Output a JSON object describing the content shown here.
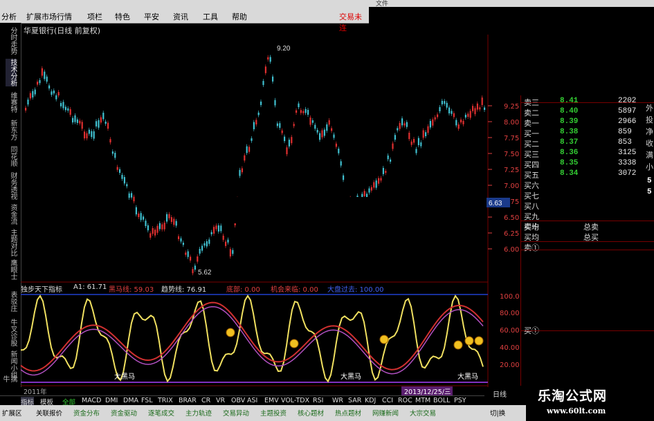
{
  "menu": {
    "items": [
      "分析",
      "扩展市场行情",
      "项栏",
      "特色",
      "平安",
      "资讯",
      "工具",
      "帮助"
    ],
    "right_label": "交易未连",
    "window_menu": "文件"
  },
  "sidebar": {
    "items": [
      "分时走势",
      "技术分析",
      "维赛特",
      "新东方",
      "同花顺",
      "财务透视",
      "资金流",
      "主题对比",
      "鹰眼士",
      "表驳庄",
      "牛叉诊股",
      "新闻小组",
      "擒牛"
    ]
  },
  "chart": {
    "title": "华夏银行(日线 前复权)",
    "high_label": "9.20",
    "low_label": "5.62",
    "price_axis": [
      "9.25",
      "8.00",
      "7.75",
      "7.50",
      "7.25",
      "7.00",
      "6.75",
      "6.50",
      "6.25",
      "6.00"
    ],
    "current_price": "6.63",
    "colors": {
      "up": "#e03030",
      "down": "#40c0d0",
      "ma": "#e0e0e0"
    }
  },
  "indicator": {
    "name": "独步天下指标",
    "a1": "A1: 61.71",
    "heima": "黑马线: 59.03",
    "trend": "趋势线: 76.91",
    "kuangu": "底部: 0.00",
    "jihui": "机会来临: 0.00",
    "dakeguo": "大盘过去: 100.00",
    "axis": [
      "100.0",
      "80.00",
      "60.00",
      "40.00",
      "20.00"
    ],
    "annot": [
      "大黑马",
      "大黑马",
      "大黑马"
    ],
    "timeline_left": "2011年",
    "date_tag": "2013/12/25/三",
    "period": "日线"
  },
  "quote": {
    "rows": [
      {
        "label": "卖三",
        "price": "8.41",
        "vol": "2202"
      },
      {
        "label": "卖二",
        "price": "8.40",
        "vol": "5897"
      },
      {
        "label": "卖一",
        "price": "8.39",
        "vol": "2966"
      },
      {
        "label": "买一",
        "price": "8.38",
        "vol": "859"
      },
      {
        "label": "买二",
        "price": "8.37",
        "vol": "853"
      },
      {
        "label": "买三",
        "price": "8.36",
        "vol": "3125"
      },
      {
        "label": "买四",
        "price": "8.35",
        "vol": "3338"
      },
      {
        "label": "买五",
        "price": "8.34",
        "vol": "3072"
      },
      {
        "label": "买六",
        "price": "",
        "vol": ""
      },
      {
        "label": "买七",
        "price": "",
        "vol": ""
      },
      {
        "label": "买八",
        "price": "",
        "vol": ""
      },
      {
        "label": "买九",
        "price": "",
        "vol": ""
      },
      {
        "label": "买十",
        "price": "",
        "vol": ""
      }
    ],
    "avg_sell": "卖均",
    "total_sell": "总卖",
    "avg_buy": "买均",
    "total_buy": "总买",
    "sell1_label": "卖①",
    "buy1_label": "买①",
    "side_chars": [
      "外",
      "投",
      "净",
      "收",
      "满",
      "小"
    ],
    "side_vals": [
      "5",
      "5"
    ]
  },
  "tabs": [
    "指标",
    "模板",
    "全部",
    "MACD",
    "DMI",
    "DMA",
    "FSL",
    "TRIX",
    "BRAR",
    "CR",
    "VR",
    "OBV",
    "ASI",
    "EMV",
    "VOL-TDX",
    "RSI",
    "WR",
    "SAR",
    "KDJ",
    "CCI",
    "ROC",
    "MTM",
    "BOLL",
    "PSY"
  ],
  "bottom": [
    "扩展区",
    "关联报价",
    "资金分布",
    "资金驱动",
    "逐笔成交",
    "主力轨迹",
    "交易异动",
    "主题投资",
    "核心题材",
    "热点题材",
    "网赚新闻",
    "大宗交易"
  ],
  "bottom_right": "切|换",
  "logo": {
    "main": "乐淘公式网",
    "url": "www.60lt.com"
  }
}
